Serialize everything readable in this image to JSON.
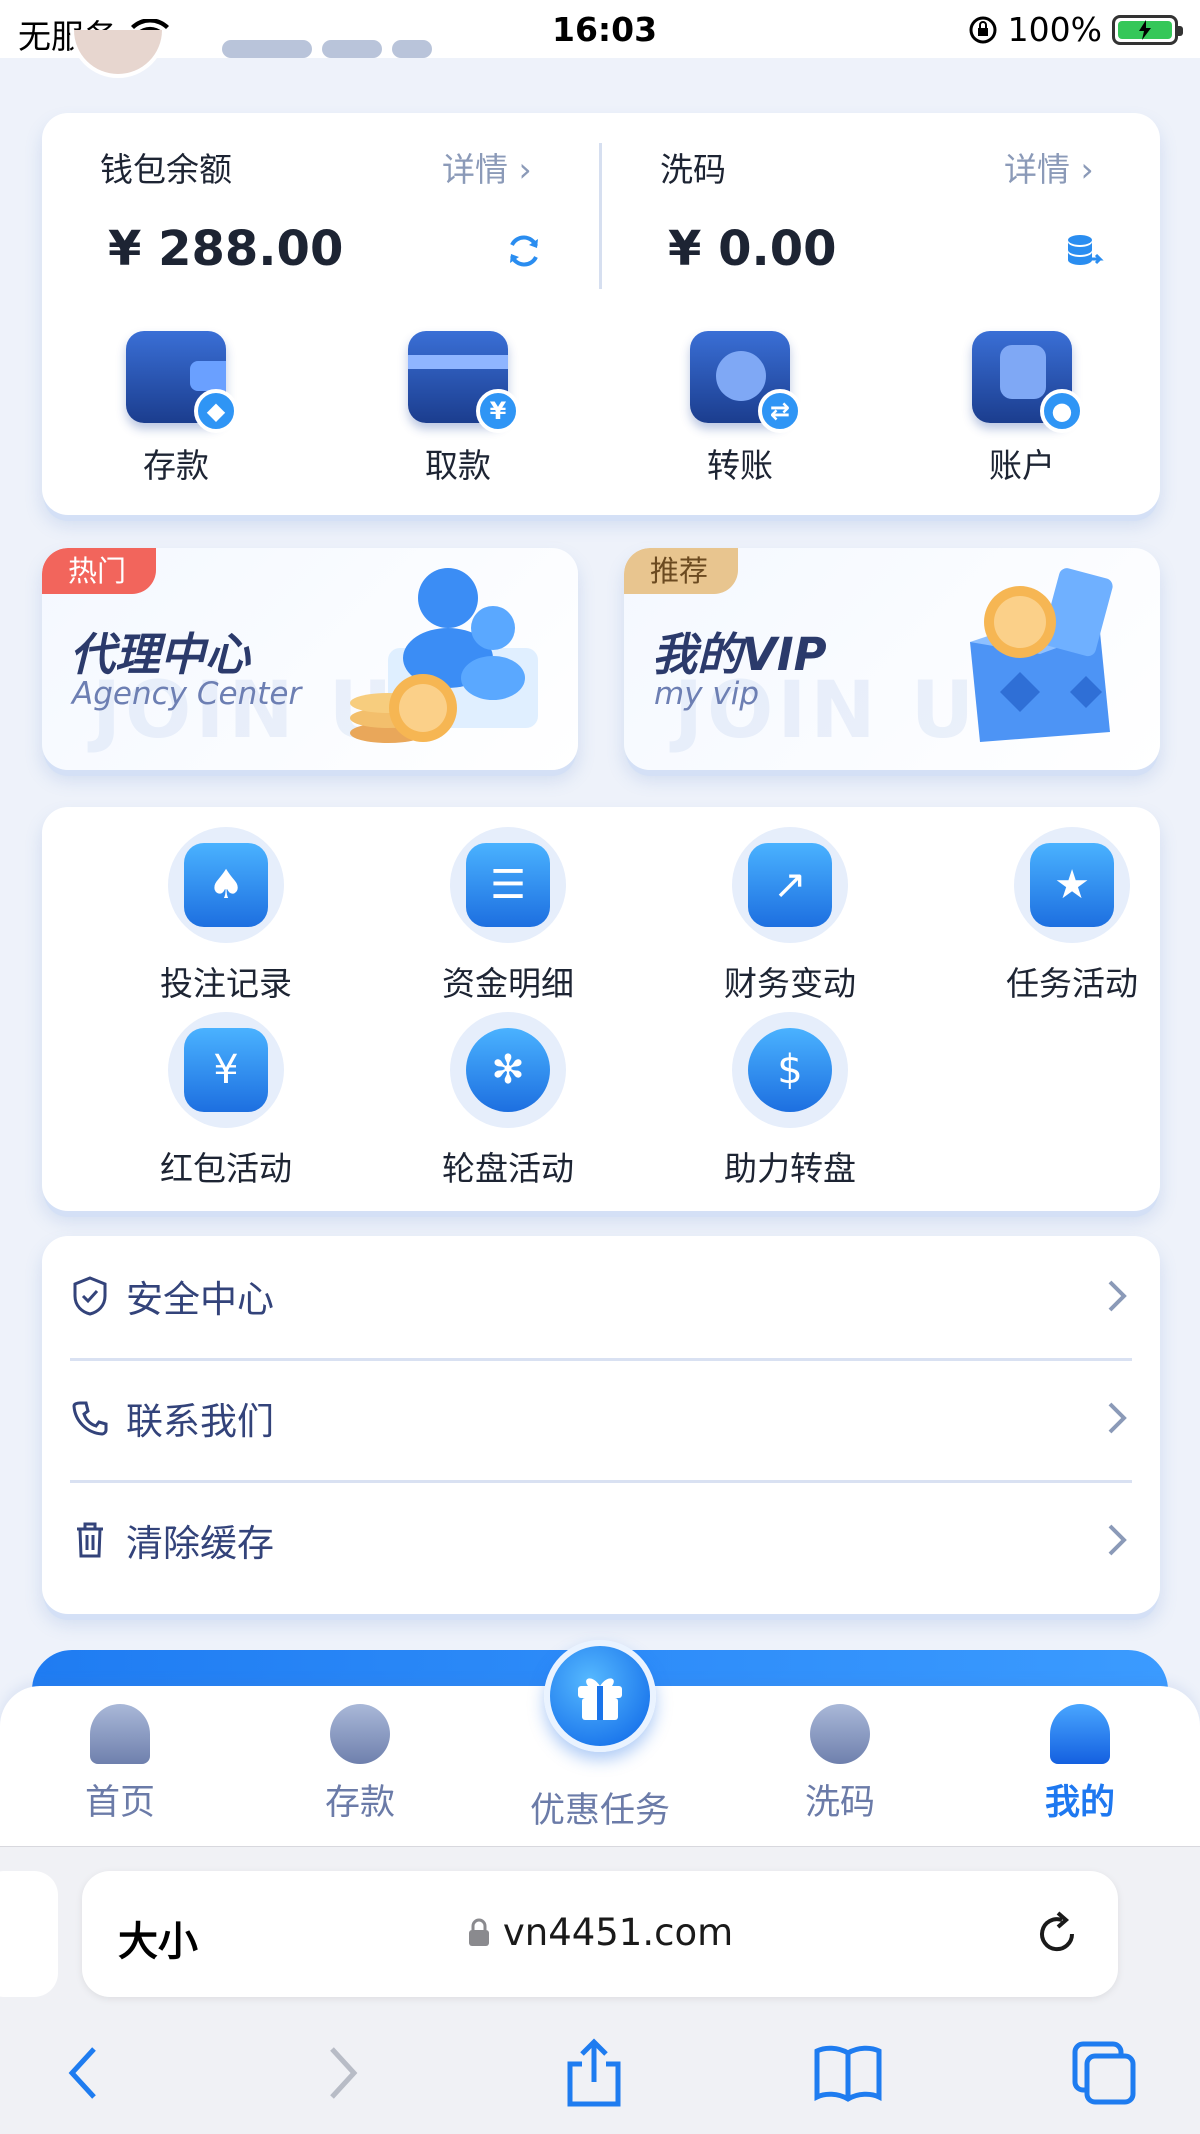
{
  "status_bar": {
    "carrier": "无服务",
    "time": "16:03",
    "battery": "100%"
  },
  "wallet": {
    "balance_title": "钱包余额",
    "balance_detail": "详情 ›",
    "balance_amount": "¥ 288.00",
    "wash_title": "洗码",
    "wash_detail": "详情 ›",
    "wash_amount": "¥ 0.00",
    "actions": [
      {
        "label": "存款",
        "badge": "◆"
      },
      {
        "label": "取款",
        "badge": "¥"
      },
      {
        "label": "转账",
        "badge": "⇄"
      },
      {
        "label": "账户",
        "badge": "●"
      }
    ]
  },
  "promos": [
    {
      "tag": "热门",
      "title": "代理中心",
      "subtitle": "Agency Center",
      "watermark": "JOIN US",
      "tag_color": "#f2655c"
    },
    {
      "tag": "推荐",
      "title": "我的VIP",
      "subtitle": "my vip",
      "watermark": "JOIN US",
      "tag_color": "#e8c58f"
    }
  ],
  "features": [
    {
      "label": "投注记录",
      "icon": "♠"
    },
    {
      "label": "资金明细",
      "icon": "☰"
    },
    {
      "label": "财务变动",
      "icon": "↗"
    },
    {
      "label": "任务活动",
      "icon": "★"
    },
    {
      "label": "红包活动",
      "icon": "¥"
    },
    {
      "label": "轮盘活动",
      "icon": "✻"
    },
    {
      "label": "助力转盘",
      "icon": "$"
    }
  ],
  "menu": [
    {
      "label": "安全中心",
      "icon": "shield-icon"
    },
    {
      "label": "联系我们",
      "icon": "phone-icon"
    },
    {
      "label": "清除缓存",
      "icon": "trash-icon"
    }
  ],
  "tabbar": {
    "items": [
      {
        "label": "首页"
      },
      {
        "label": "存款"
      },
      {
        "label": "优惠任务"
      },
      {
        "label": "洗码"
      },
      {
        "label": "我的"
      }
    ],
    "active_color": "#1e78f0"
  },
  "browser": {
    "text_size_label": "大小",
    "url": "vn4451.com"
  }
}
